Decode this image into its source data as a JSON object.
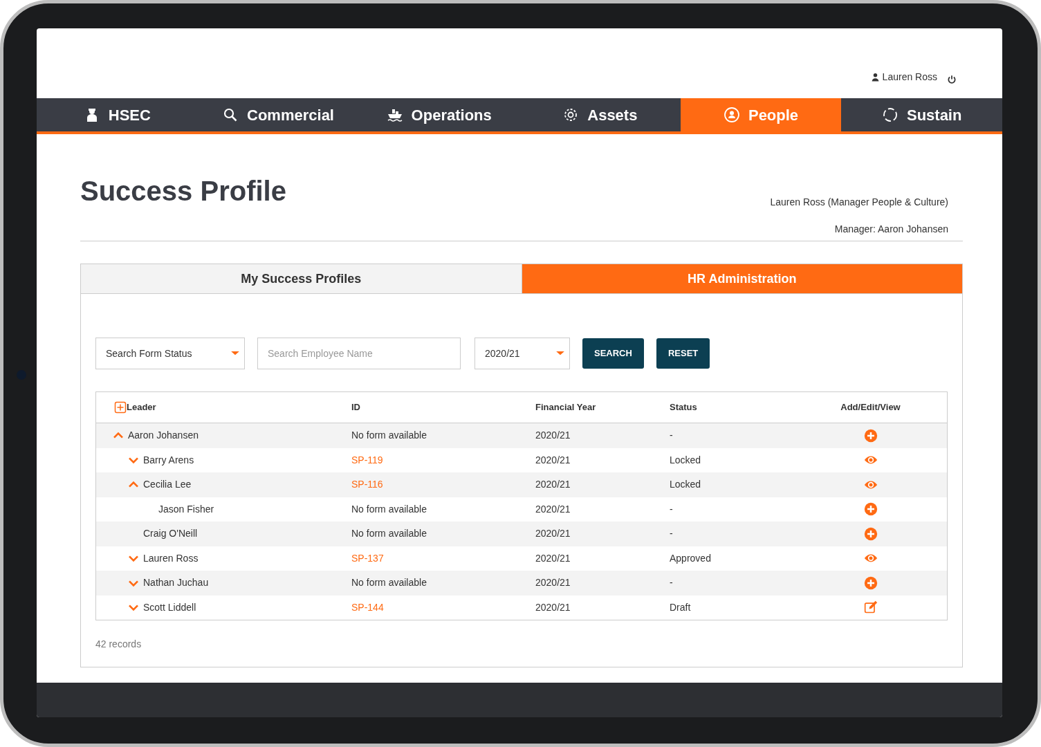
{
  "header": {
    "user_name": "Lauren Ross"
  },
  "nav": [
    {
      "label": "HSEC",
      "selected": false
    },
    {
      "label": "Commercial",
      "selected": false
    },
    {
      "label": "Operations",
      "selected": false
    },
    {
      "label": "Assets",
      "selected": false
    },
    {
      "label": "People",
      "selected": true
    },
    {
      "label": "Sustain",
      "selected": false
    }
  ],
  "page": {
    "title": "Success Profile",
    "user_role": "Lauren Ross (Manager People & Culture)",
    "manager": "Manager: Aaron Johansen"
  },
  "tabs": [
    {
      "label": "My Success Profiles",
      "selected": false
    },
    {
      "label": "HR Administration",
      "selected": true
    }
  ],
  "filters": {
    "status": {
      "value": "Search Form Status"
    },
    "employee": {
      "placeholder": "Search Employee Name"
    },
    "year": {
      "value": "2020/21"
    },
    "buttons": [
      "SEARCH",
      "RESET"
    ]
  },
  "table": {
    "columns": [
      "Leader",
      "ID",
      "Financial Year",
      "Status",
      "Add/Edit/View"
    ],
    "rows": [
      {
        "leader": "Aaron Johansen",
        "expanded": true,
        "id": "No form available",
        "has_form": false,
        "year": "2020/21",
        "status": "-",
        "kind": "add",
        "children": [
          {
            "leader": "Barry Arens",
            "expanded": false,
            "id": "SP-119",
            "has_form": true,
            "year": "2020/21",
            "status": "Locked",
            "kind": "view"
          },
          {
            "leader": "Cecilia Lee",
            "expanded": true,
            "id": "SP-116",
            "has_form": true,
            "year": "2020/21",
            "status": "Locked",
            "kind": "view",
            "children": [
              {
                "leader": "Jason Fisher",
                "id": "No form available",
                "has_form": false,
                "year": "2020/21",
                "status": "-",
                "kind": "add"
              }
            ]
          },
          {
            "leader": "Craig O'Neill",
            "id": "No form available",
            "has_form": false,
            "year": "2020/21",
            "status": "-",
            "kind": "add"
          },
          {
            "leader": "Lauren Ross",
            "expanded": false,
            "id": "SP-137",
            "has_form": true,
            "year": "2020/21",
            "status": "Approved",
            "kind": "view"
          },
          {
            "leader": "Nathan Juchau",
            "expanded": false,
            "id": "No form available",
            "has_form": false,
            "year": "2020/21",
            "status": "-",
            "kind": "add"
          },
          {
            "leader": "Scott Liddell",
            "expanded": false,
            "id": "SP-144",
            "has_form": true,
            "year": "2020/21",
            "status": "Draft",
            "kind": "edit"
          }
        ]
      }
    ]
  },
  "record_count": "42 records"
}
